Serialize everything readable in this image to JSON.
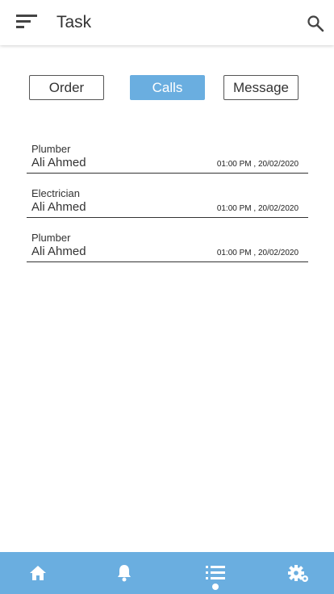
{
  "header": {
    "title": "Task",
    "menu_icon": "menu-icon",
    "search_icon": "search-icon"
  },
  "tabs": [
    {
      "label": "Order",
      "active": false
    },
    {
      "label": "Calls",
      "active": true
    },
    {
      "label": "Message",
      "active": false
    }
  ],
  "list": [
    {
      "role": "Plumber",
      "name": "Ali Ahmed",
      "time": "01:00 PM , 20/02/2020"
    },
    {
      "role": "Electrician",
      "name": "Ali Ahmed",
      "time": "01:00 PM , 20/02/2020"
    },
    {
      "role": "Plumber",
      "name": "Ali Ahmed",
      "time": "01:00 PM , 20/02/2020"
    }
  ],
  "bottom_nav": {
    "items": [
      {
        "icon": "home-icon",
        "active": false
      },
      {
        "icon": "bell-icon",
        "active": false
      },
      {
        "icon": "list-icon",
        "active": true
      },
      {
        "icon": "settings-icon",
        "active": false
      }
    ],
    "color": "#6aaee0"
  },
  "colors": {
    "accent": "#6aaee0"
  }
}
